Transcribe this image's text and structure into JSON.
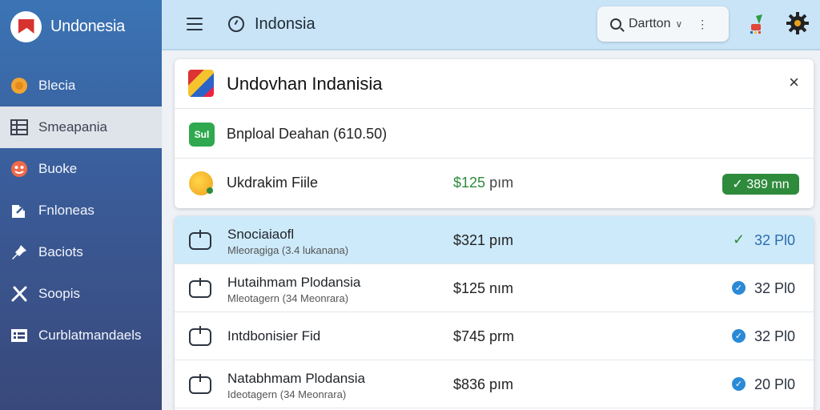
{
  "sidebar": {
    "brand_title": "Undonesia",
    "items": [
      {
        "label": "Blecia",
        "icon": "coin-icon"
      },
      {
        "label": "Smeapania",
        "icon": "table-icon",
        "active": true
      },
      {
        "label": "Buoke",
        "icon": "emoji-icon"
      },
      {
        "label": "Fnloneas",
        "icon": "external-link-icon"
      },
      {
        "label": "Baciots",
        "icon": "pin-icon"
      },
      {
        "label": "Soopis",
        "icon": "tools-icon"
      },
      {
        "label": "Curblatmandaels",
        "icon": "list-icon"
      }
    ]
  },
  "topbar": {
    "title": "Indonsia",
    "search_label": "Dartton",
    "chevron": "∨",
    "menu": "⋮"
  },
  "card": {
    "title": "Undovhan Indanisia",
    "close": "×",
    "upload_badge": "Sul",
    "upload_text": "Bnploal Deahan (610.50)",
    "file_name": "Ukdrakim Fiile",
    "file_price": "$125",
    "file_price_unit": "pım",
    "file_status": "✓ 389 mn"
  },
  "rows": [
    {
      "name": "Snociaiaofl",
      "sub": "Mleoragiga (3.4 lukanana)",
      "price": "$321 pım",
      "value": "32 Pl0",
      "selected": true,
      "check": "green"
    },
    {
      "name": "Hutaihmam Plodansia",
      "sub": "Mleotagern (34 Meonrara)",
      "price": "$125 nım",
      "value": "32 Pl0",
      "selected": false,
      "check": "blue"
    },
    {
      "name": "Intdbonisier Fid",
      "sub": "",
      "price": "$745 prm",
      "value": "32 Pl0",
      "selected": false,
      "check": "blue"
    },
    {
      "name": "Natabhmam Plodansia",
      "sub": "Ideotagern (34 Meonrara)",
      "price": "$836 pım",
      "value": "20 Pl0",
      "selected": false,
      "check": "blue"
    }
  ],
  "colors": {
    "accent_green": "#2e8b3c",
    "accent_blue": "#2b8ad6",
    "selected_row": "#cdeafa"
  }
}
